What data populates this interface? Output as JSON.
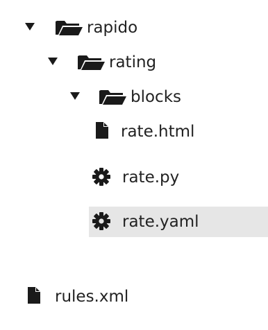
{
  "tree": {
    "rows": [
      {
        "kind": "folder",
        "expanded": true,
        "label": "rapido",
        "icon": "folder-open-icon",
        "caret": "caret-down-icon",
        "selected": false
      },
      {
        "kind": "folder",
        "expanded": true,
        "label": "rating",
        "icon": "folder-open-icon",
        "caret": "caret-down-icon",
        "selected": false
      },
      {
        "kind": "folder",
        "expanded": true,
        "label": "blocks",
        "icon": "folder-open-icon",
        "caret": "caret-down-icon",
        "selected": false
      },
      {
        "kind": "file",
        "label": "rate.html",
        "icon": "file-icon",
        "selected": false
      },
      {
        "kind": "file",
        "label": "rate.py",
        "icon": "gear-icon",
        "selected": false
      },
      {
        "kind": "file",
        "label": "rate.yaml",
        "icon": "gear-icon",
        "selected": true
      },
      {
        "kind": "file",
        "label": "rules.xml",
        "icon": "file-icon",
        "selected": false
      }
    ]
  },
  "colors": {
    "text": "#222222",
    "icon": "#1a1a1a",
    "selection": "#e6e6e6",
    "background": "#ffffff"
  }
}
